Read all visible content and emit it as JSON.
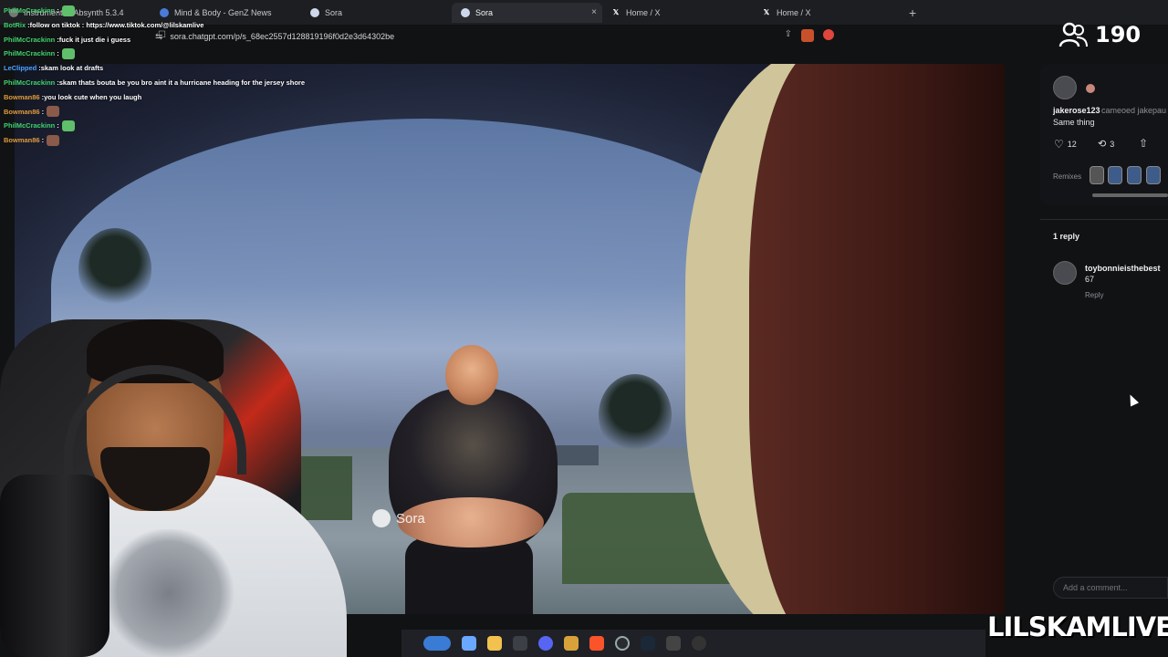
{
  "browser": {
    "tabs": [
      {
        "label": "Instruments - Absynth 5.3.4",
        "favicon": "instruments-icon",
        "active": false
      },
      {
        "label": "Mind & Body - GenZ News",
        "favicon": "genz-icon",
        "active": false
      },
      {
        "label": "Sora",
        "favicon": "sora-icon",
        "active": false
      },
      {
        "label": "Sora",
        "favicon": "sora-icon",
        "active": true
      },
      {
        "label": "Home / X",
        "favicon": "x-icon",
        "active": false
      },
      {
        "label": "Home / X",
        "favicon": "x-icon",
        "active": false
      }
    ],
    "new_tab": "+",
    "close": "×",
    "url": "sora.chatgpt.com/p/s_68ec2557d128819196f0d2e3d64302be"
  },
  "stream": {
    "viewer_count": "190",
    "watermark": "Sora",
    "brand": "LILSKAMLIVE"
  },
  "chat": [
    {
      "user": "PhilMcCrackinn",
      "user_color": "#3fd26b",
      "message": "",
      "emote": "peepo"
    },
    {
      "user": "BotRix",
      "user_color": "#3fd26b",
      "message": "follow on tiktok : https://www.tiktok.com/@lilskamlive",
      "emote": ""
    },
    {
      "user": "PhilMcCrackinn",
      "user_color": "#3fd26b",
      "message": "fuck it just die i guess",
      "emote": ""
    },
    {
      "user": "PhilMcCrackinn",
      "user_color": "#3fd26b",
      "message": "",
      "emote": "peepo"
    },
    {
      "user": "LeClipped",
      "user_color": "#4aa3ff",
      "message": "skam look at drafts",
      "emote": ""
    },
    {
      "user": "PhilMcCrackinn",
      "user_color": "#3fd26b",
      "message": "skam thats bouta be you bro aint it a hurricane heading for the jersey shore",
      "emote": ""
    },
    {
      "user": "Bowman86",
      "user_color": "#e09a3c",
      "message": "you look cute when you laugh",
      "emote": ""
    },
    {
      "user": "Bowman86",
      "user_color": "#e09a3c",
      "message": "",
      "emote": "pepe"
    },
    {
      "user": "PhilMcCrackinn",
      "user_color": "#3fd26b",
      "message": "",
      "emote": "peepo"
    },
    {
      "user": "Bowman86",
      "user_color": "#e09a3c",
      "message": "",
      "emote": "pepe"
    }
  ],
  "sidebar": {
    "author": "jakerose123",
    "cameo_text": "cameoed jakepau",
    "caption": "Same thing",
    "likes": "12",
    "remix_count": "3",
    "remixes_label": "Remixes",
    "replies_header": "1 reply",
    "reply": {
      "user": "toybonnieisthebest",
      "text": "67",
      "action": "Reply"
    },
    "comment_placeholder": "Add a comment..."
  },
  "colors": {
    "accent": "#3fd26b",
    "background": "#111214"
  }
}
